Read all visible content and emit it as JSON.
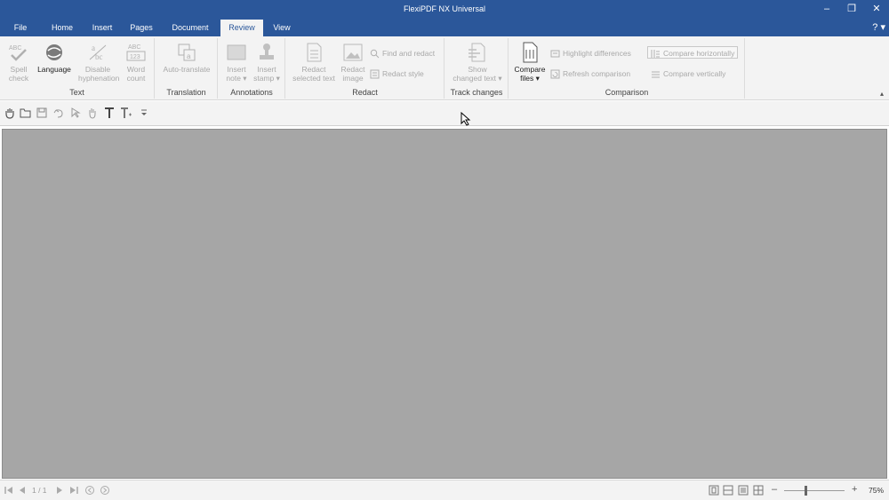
{
  "window": {
    "title": "FlexiPDF NX Universal",
    "minimize": "–",
    "restore": "❐",
    "close": "✕",
    "help": "? ▾"
  },
  "tabs": [
    {
      "label": "File"
    },
    {
      "label": "Home"
    },
    {
      "label": "Insert"
    },
    {
      "label": "Pages"
    },
    {
      "label": "Document"
    },
    {
      "label": "Review"
    },
    {
      "label": "View"
    }
  ],
  "ribbon": {
    "text_group": {
      "label": "Text",
      "spell_check": "Spell\ncheck",
      "language": "Language",
      "disable_hyphenation": "Disable\nhyphenation",
      "word_count": "Word\ncount"
    },
    "translation_group": {
      "label": "Translation",
      "auto_translate": "Auto-translate"
    },
    "annotations_group": {
      "label": "Annotations",
      "insert_note": "Insert\nnote ▾",
      "insert_stamp": "Insert\nstamp ▾"
    },
    "redact_group": {
      "label": "Redact",
      "redact_selected_text": "Redact\nselected text",
      "redact_image": "Redact\nimage",
      "find_and_redact": "Find and redact",
      "redact_style": "Redact style"
    },
    "track_group": {
      "label": "Track changes",
      "show_changed_text": "Show\nchanged text ▾"
    },
    "comparison_group": {
      "label": "Comparison",
      "compare_files": "Compare\nfiles ▾",
      "highlight_differences": "Highlight differences",
      "refresh_comparison": "Refresh comparison",
      "compare_horizontally": "Compare horizontally",
      "compare_vertically": "Compare vertically"
    },
    "collapse": "▴"
  },
  "statusbar": {
    "page_indicator": "1 / 1",
    "zoom_minus": "–",
    "zoom_plus": "+",
    "zoom_level": "75%",
    "zoom_fraction": 0.35
  },
  "colors": {
    "titlebar": "#2b579a",
    "ribbon": "#f3f3f3",
    "canvas": "#a6a6a6"
  }
}
